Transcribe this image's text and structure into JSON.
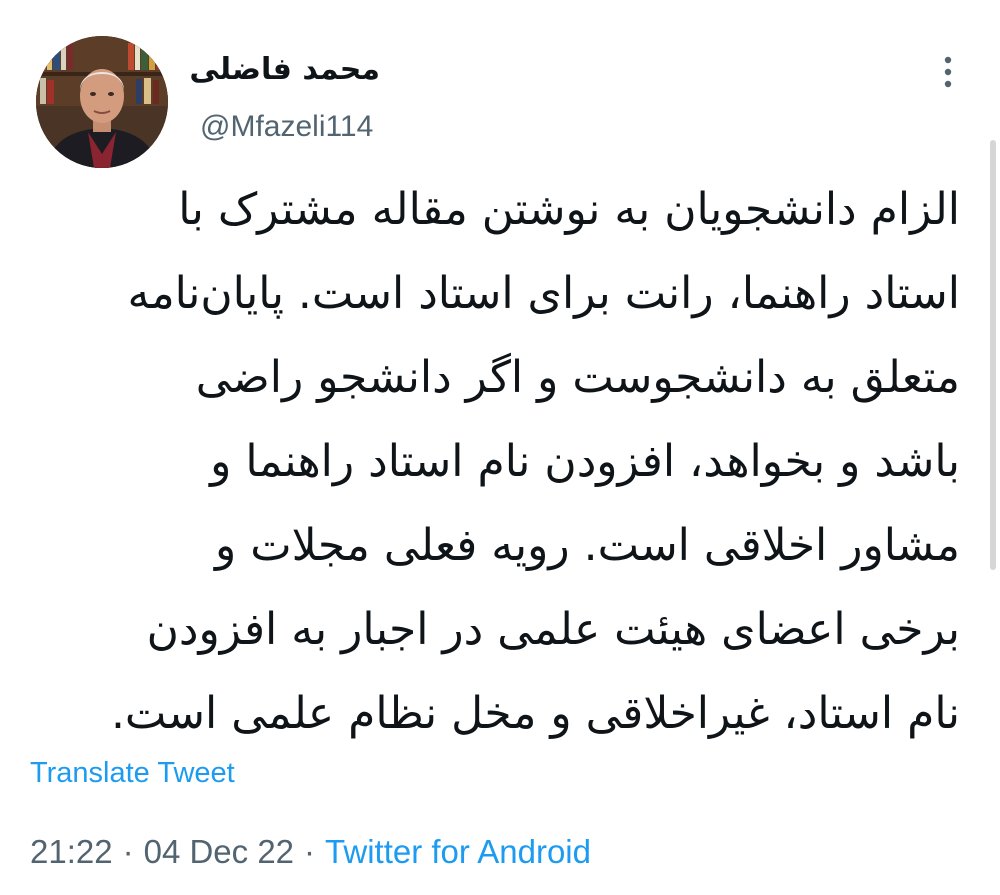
{
  "author": {
    "display_name": "محمد فاضلی",
    "handle": "@Mfazeli114",
    "avatar_icon": "person-photo-avatar"
  },
  "menu": {
    "icon": "vertical-ellipsis-icon"
  },
  "tweet": {
    "lines": [
      "الزام دانشجویان به نوشتن مقاله مشترک با",
      "استاد راهنما، رانت برای استاد است. پایان‌نامه",
      "متعلق به دانشجوست و اگر دانشجو راضی",
      "باشد و بخواهد، افزودن نام استاد راهنما و",
      "مشاور اخلاقی است. رویه فعلی مجلات و",
      "برخی اعضای هیئت علمی در اجبار به افزودن",
      "نام استاد، غیراخلاقی و مخل نظام علمی است."
    ],
    "translate_label": "Translate Tweet"
  },
  "meta": {
    "time": "21:22",
    "date": "04 Dec 22",
    "separator": "·",
    "source": "Twitter for Android"
  },
  "colors": {
    "link": "#1d9bf0",
    "secondary_text": "#536471",
    "primary_text": "#0f1419"
  }
}
